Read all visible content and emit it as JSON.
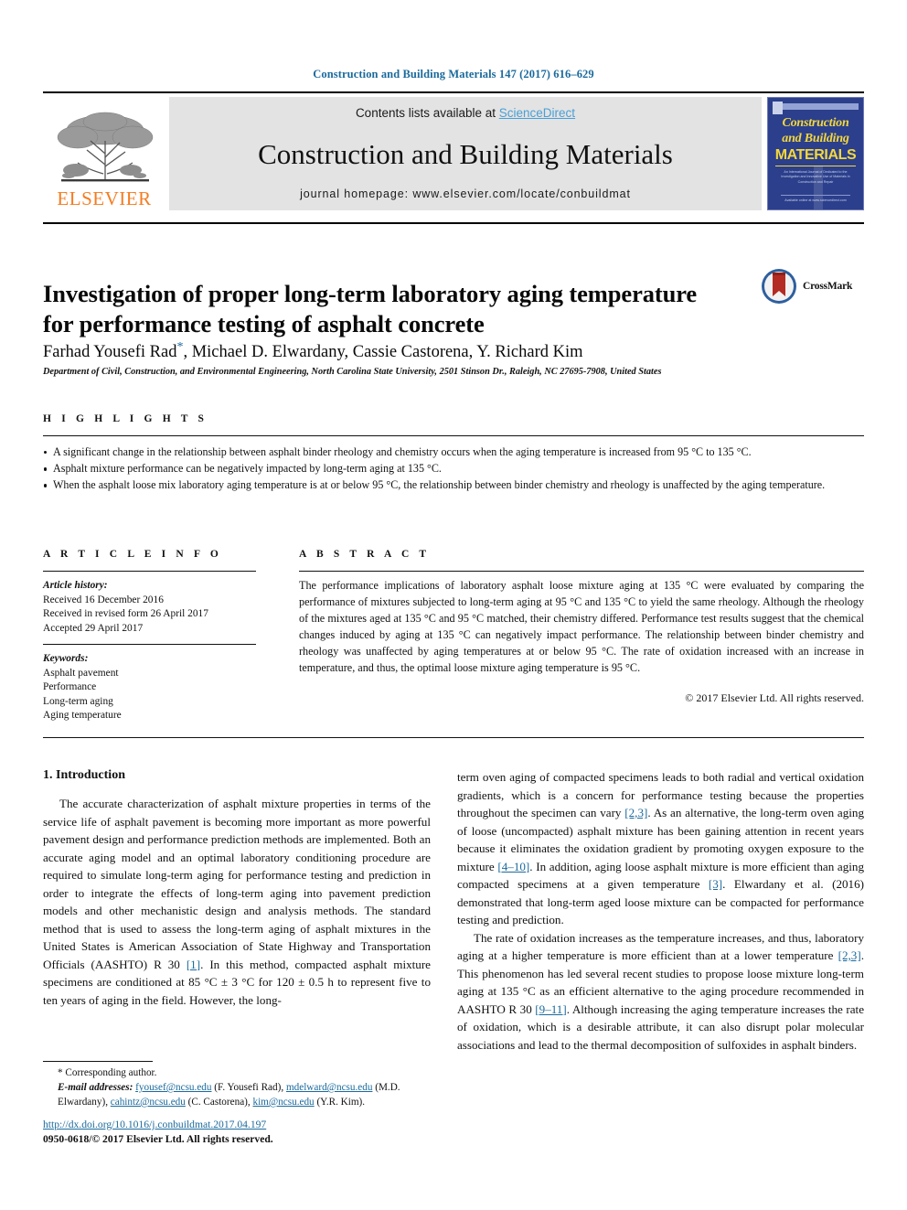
{
  "running_head": "Construction and Building Materials 147 (2017) 616–629",
  "masthead": {
    "publisher_name": "ELSEVIER",
    "contents_prefix": "Contents lists available at ",
    "contents_link": "ScienceDirect",
    "journal_name": "Construction and Building Materials",
    "journal_homepage": "journal homepage: www.elsevier.com/locate/conbuildmat",
    "cover": {
      "line1": "Construction",
      "line2": "and Building",
      "line3": "MATERIALS",
      "blurb": "An International Journal of Dedicated to the Investigation and Innovative Use of Materials in Construction and Repair",
      "foot": "Available online at www.sciencedirect.com"
    }
  },
  "article": {
    "title": "Investigation of proper long-term laboratory aging temperature for performance testing of asphalt concrete",
    "crossmark_label": "CrossMark",
    "authors": "Farhad Yousefi Rad , Michael D. Elwardany, Cassie Castorena, Y. Richard Kim",
    "author_star": "*",
    "affiliation": "Department of Civil, Construction, and Environmental Engineering, North Carolina State University, 2501 Stinson Dr., Raleigh, NC 27695-7908, United States"
  },
  "highlights": {
    "heading": "H I G H L I G H T S",
    "items": [
      "A significant change in the relationship between asphalt binder rheology and chemistry occurs when the aging temperature is increased from 95 °C to 135 °C.",
      "Asphalt mixture performance can be negatively impacted by long-term aging at 135 °C.",
      "When the asphalt loose mix laboratory aging temperature is at or below 95 °C, the relationship between binder chemistry and rheology is unaffected by the aging temperature."
    ]
  },
  "article_info": {
    "heading": "A R T I C L E   I N F O",
    "history_label": "Article history:",
    "history": [
      "Received 16 December 2016",
      "Received in revised form 26 April 2017",
      "Accepted 29 April 2017"
    ],
    "keywords_label": "Keywords:",
    "keywords": [
      "Asphalt pavement",
      "Performance",
      "Long-term aging",
      "Aging temperature"
    ]
  },
  "abstract": {
    "heading": "A B S T R A C T",
    "text": "The performance implications of laboratory asphalt loose mixture aging at 135 °C were evaluated by comparing the performance of mixtures subjected to long-term aging at 95 °C and 135 °C to yield the same rheology. Although the rheology of the mixtures aged at 135 °C and 95 °C matched, their chemistry differed. Performance test results suggest that the chemical changes induced by aging at 135 °C can negatively impact performance. The relationship between binder chemistry and rheology was unaffected by aging temperatures at or below 95 °C. The rate of oxidation increased with an increase in temperature, and thus, the optimal loose mixture aging temperature is 95 °C.",
    "copyright": "© 2017 Elsevier Ltd. All rights reserved."
  },
  "introduction": {
    "section_title": "1. Introduction",
    "left_para_1_a": "The accurate characterization of asphalt mixture properties in terms of the service life of asphalt pavement is becoming more important as more powerful pavement design and performance prediction methods are implemented. Both an accurate aging model and an optimal laboratory conditioning procedure are required to simulate long-term aging for performance testing and prediction in order to integrate the effects of long-term aging into pavement prediction models and other mechanistic design and analysis methods. The standard method that is used to assess the long-term aging of asphalt mixtures in the United States is American Association of State Highway and Transportation Officials (AASHTO) R 30 ",
    "left_ref_1": "[1]",
    "left_para_1_b": ". In this method, compacted asphalt mixture specimens are conditioned at 85 °C ± 3 °C for 120 ± 0.5 h to represent five to ten years of aging in the field. However, the long-",
    "right_para_1_a": "term oven aging of compacted specimens leads to both radial and vertical oxidation gradients, which is a concern for performance testing because the properties throughout the specimen can vary ",
    "right_ref_1": "[2,3]",
    "right_para_1_b": ". As an alternative, the long-term oven aging of loose (uncompacted) asphalt mixture has been gaining attention in recent years because it eliminates the oxidation gradient by promoting oxygen exposure to the mixture ",
    "right_ref_2": "[4–10]",
    "right_para_1_c": ". In addition, aging loose asphalt mixture is more efficient than aging compacted specimens at a given temperature ",
    "right_ref_3": "[3]",
    "right_para_1_d": ". Elwardany et al. (2016) demonstrated that long-term aged loose mixture can be compacted for performance testing and prediction.",
    "right_para_2_a": "The rate of oxidation increases as the temperature increases, and thus, laboratory aging at a higher temperature is more efficient than at a lower temperature ",
    "right_ref_4": "[2,3]",
    "right_para_2_b": ". This phenomenon has led several recent studies to propose loose mixture long-term aging at 135 °C as an efficient alternative to the aging procedure recommended in AASHTO R 30 ",
    "right_ref_5": "[9–11]",
    "right_para_2_c": ". Although increasing the aging temperature increases the rate of oxidation, which is a desirable attribute, it can also disrupt polar molecular associations and lead to the thermal decomposition of sulfoxides in asphalt binders."
  },
  "footnote": {
    "corresponding": "* Corresponding author.",
    "email_label": "E-mail addresses:",
    "emails": [
      {
        "address": "fyousef@ncsu.edu",
        "person": "(F. Yousefi Rad)"
      },
      {
        "address": "mdelward@ncsu.edu",
        "person": "(M.D. Elwardany)"
      },
      {
        "address": "cahintz@ncsu.edu",
        "person": "(C. Castorena)"
      },
      {
        "address": "kim@ncsu.edu",
        "person": "(Y.R. Kim)"
      }
    ],
    "doi": "http://dx.doi.org/10.1016/j.conbuildmat.2017.04.197",
    "issn_line": "0950-0618/© 2017 Elsevier Ltd. All rights reserved."
  },
  "colors": {
    "link": "#1b6a9c",
    "sciencedirect": "#4a9fd5",
    "elsevier_orange": "#f57c20",
    "cover_blue": "#2b3f8c",
    "cover_yellow": "#f4d73c",
    "band_grey": "#e3e3e3"
  }
}
